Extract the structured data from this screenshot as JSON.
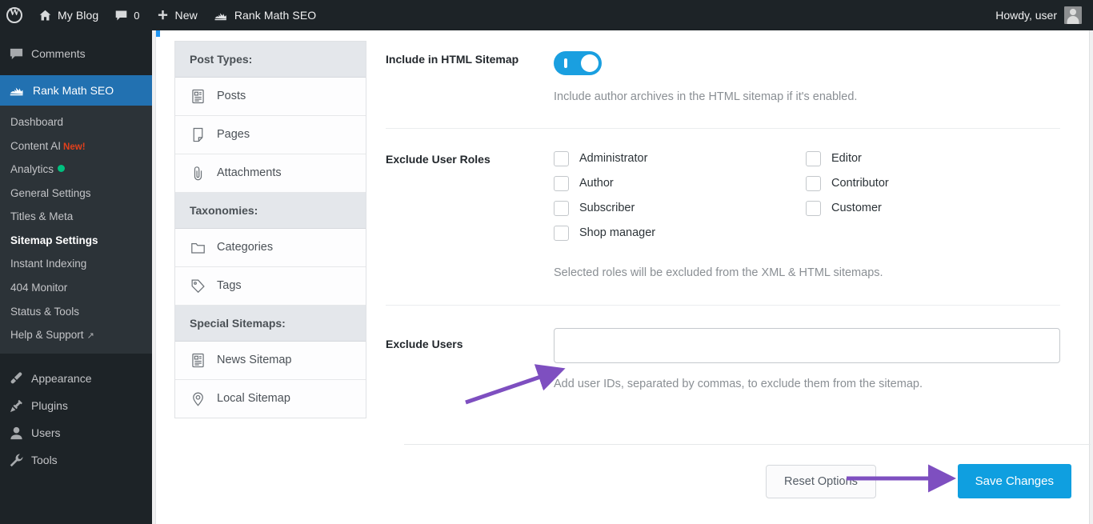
{
  "adminbar": {
    "logo_icon": "wordpress-logo-icon",
    "site_name": "My Blog",
    "site_icon": "home-icon",
    "comments_icon": "comment-bubble-icon",
    "comments_count": "0",
    "new_icon": "plus-icon",
    "new_label": "New",
    "rankmath_icon": "rank-math-icon",
    "rankmath_label": "Rank Math SEO",
    "howdy": "Howdy, user",
    "avatar_icon": "user-avatar-icon"
  },
  "sidebar": {
    "items": [
      {
        "label": "Comments",
        "icon": "comment-bubble-icon",
        "current": false
      },
      {
        "label": "Rank Math SEO",
        "icon": "rank-math-icon",
        "current": true
      }
    ],
    "submenu": [
      {
        "label": "Dashboard",
        "current": false
      },
      {
        "label": "Content AI",
        "current": false,
        "badge": "New!"
      },
      {
        "label": "Analytics",
        "current": false,
        "dot": true
      },
      {
        "label": "General Settings",
        "current": false
      },
      {
        "label": "Titles & Meta",
        "current": false
      },
      {
        "label": "Sitemap Settings",
        "current": true
      },
      {
        "label": "Instant Indexing",
        "current": false
      },
      {
        "label": "404 Monitor",
        "current": false
      },
      {
        "label": "Status & Tools",
        "current": false
      },
      {
        "label": "Help & Support",
        "current": false,
        "external": "↗"
      }
    ],
    "bottom_items": [
      {
        "label": "Appearance",
        "icon": "paintbrush-icon"
      },
      {
        "label": "Plugins",
        "icon": "plug-icon"
      },
      {
        "label": "Users",
        "icon": "user-icon"
      },
      {
        "label": "Tools",
        "icon": "wrench-icon"
      }
    ]
  },
  "settings_nav": {
    "groups": [
      {
        "heading": "Post Types:",
        "items": [
          {
            "label": "Posts",
            "icon": "post-document-icon"
          },
          {
            "label": "Pages",
            "icon": "page-icon"
          },
          {
            "label": "Attachments",
            "icon": "paperclip-icon"
          }
        ]
      },
      {
        "heading": "Taxonomies:",
        "items": [
          {
            "label": "Categories",
            "icon": "folder-icon"
          },
          {
            "label": "Tags",
            "icon": "tag-icon"
          }
        ]
      },
      {
        "heading": "Special Sitemaps:",
        "items": [
          {
            "label": "News Sitemap",
            "icon": "news-document-icon"
          },
          {
            "label": "Local Sitemap",
            "icon": "map-pin-icon"
          }
        ]
      }
    ]
  },
  "form": {
    "include_html_sitemap": {
      "label": "Include in HTML Sitemap",
      "toggle_state": "on",
      "help": "Include author archives in the HTML sitemap if it's enabled."
    },
    "exclude_user_roles": {
      "label": "Exclude User Roles",
      "help": "Selected roles will be excluded from the XML & HTML sitemaps.",
      "column_one": [
        {
          "label": "Administrator",
          "checked": false
        },
        {
          "label": "Author",
          "checked": false
        },
        {
          "label": "Subscriber",
          "checked": false
        },
        {
          "label": "Shop manager",
          "checked": false
        }
      ],
      "column_two": [
        {
          "label": "Editor",
          "checked": false
        },
        {
          "label": "Contributor",
          "checked": false
        },
        {
          "label": "Customer",
          "checked": false
        }
      ]
    },
    "exclude_users": {
      "label": "Exclude Users",
      "value": "",
      "placeholder": "",
      "help": "Add user IDs, separated by commas, to exclude them from the sitemap."
    }
  },
  "footer": {
    "reset_label": "Reset Options",
    "save_label": "Save Changes"
  },
  "annotations": {
    "arrow_color": "#7e4fc0",
    "arrows": [
      {
        "name": "arrow-to-exclude-users-field"
      },
      {
        "name": "arrow-to-save-changes-button"
      }
    ]
  },
  "colors": {
    "admin_dark": "#1d2327",
    "admin_submenu": "#2c3338",
    "accent_blue": "#2271b1",
    "toggle_blue": "#1a9fe0",
    "save_blue": "#0f9fe0",
    "badge_red": "#e2401c",
    "dot_green": "#00c07f"
  }
}
